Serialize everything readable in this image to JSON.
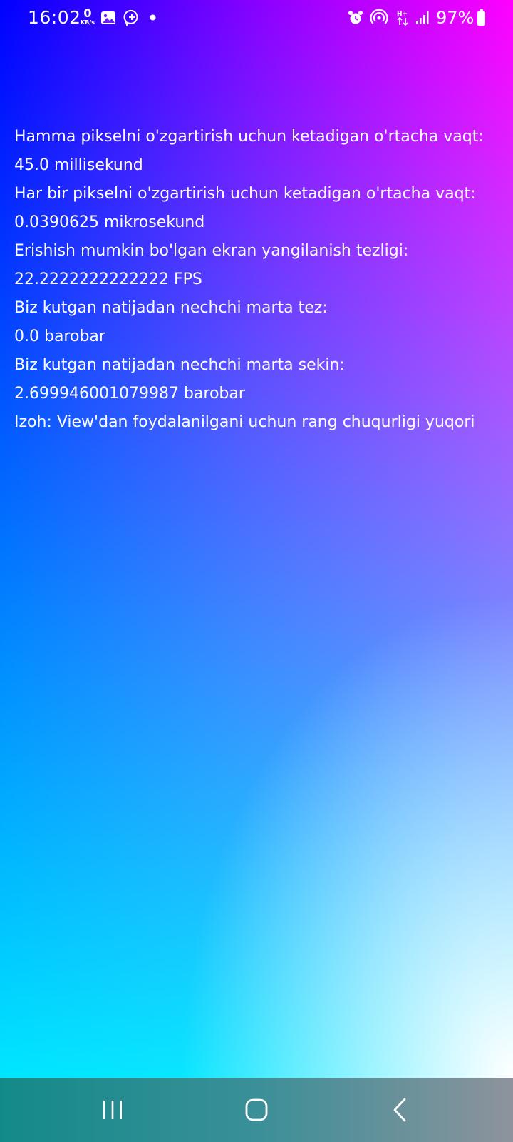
{
  "status_bar": {
    "time": "16:02",
    "net_speed_value": "0",
    "net_speed_unit": "KB/s",
    "battery_percent": "97%",
    "left_icons": [
      "image-icon",
      "assistant-icon",
      "dot-icon"
    ],
    "right_icons": [
      "alarm-icon",
      "hotspot-icon",
      "data-arrows-icon",
      "signal-icon",
      "battery-icon"
    ]
  },
  "content": {
    "lines": [
      "Hamma pikselni o'zgartirish uchun ketadigan o'rtacha vaqt:",
      "45.0 millisekund",
      "Har bir pikselni o'zgartirish uchun ketadigan o'rtacha vaqt:",
      "0.0390625 mikrosekund",
      "Erishish mumkin bo'lgan ekran yangilanish tezligi:",
      "22.2222222222222 FPS",
      "Biz kutgan natijadan nechchi marta tez:",
      "0.0 barobar",
      "Biz kutgan natijadan nechchi marta sekin:",
      "2.699946001079987 barobar",
      "Izoh: View'dan foydalanilgani uchun rang chuqurligi yuqori"
    ]
  },
  "navigation_bar": {
    "buttons": [
      "recent-apps-icon",
      "home-icon",
      "back-icon"
    ]
  },
  "colors": {
    "gradient_top_left": "#0000ff",
    "gradient_top_right": "#ff00ff",
    "gradient_bottom_left": "#00ffff",
    "gradient_bottom_right": "#ffffff",
    "text": "#ffffff",
    "nav_bar_left": "#138a8a",
    "nav_bar_right": "#8e939c"
  }
}
